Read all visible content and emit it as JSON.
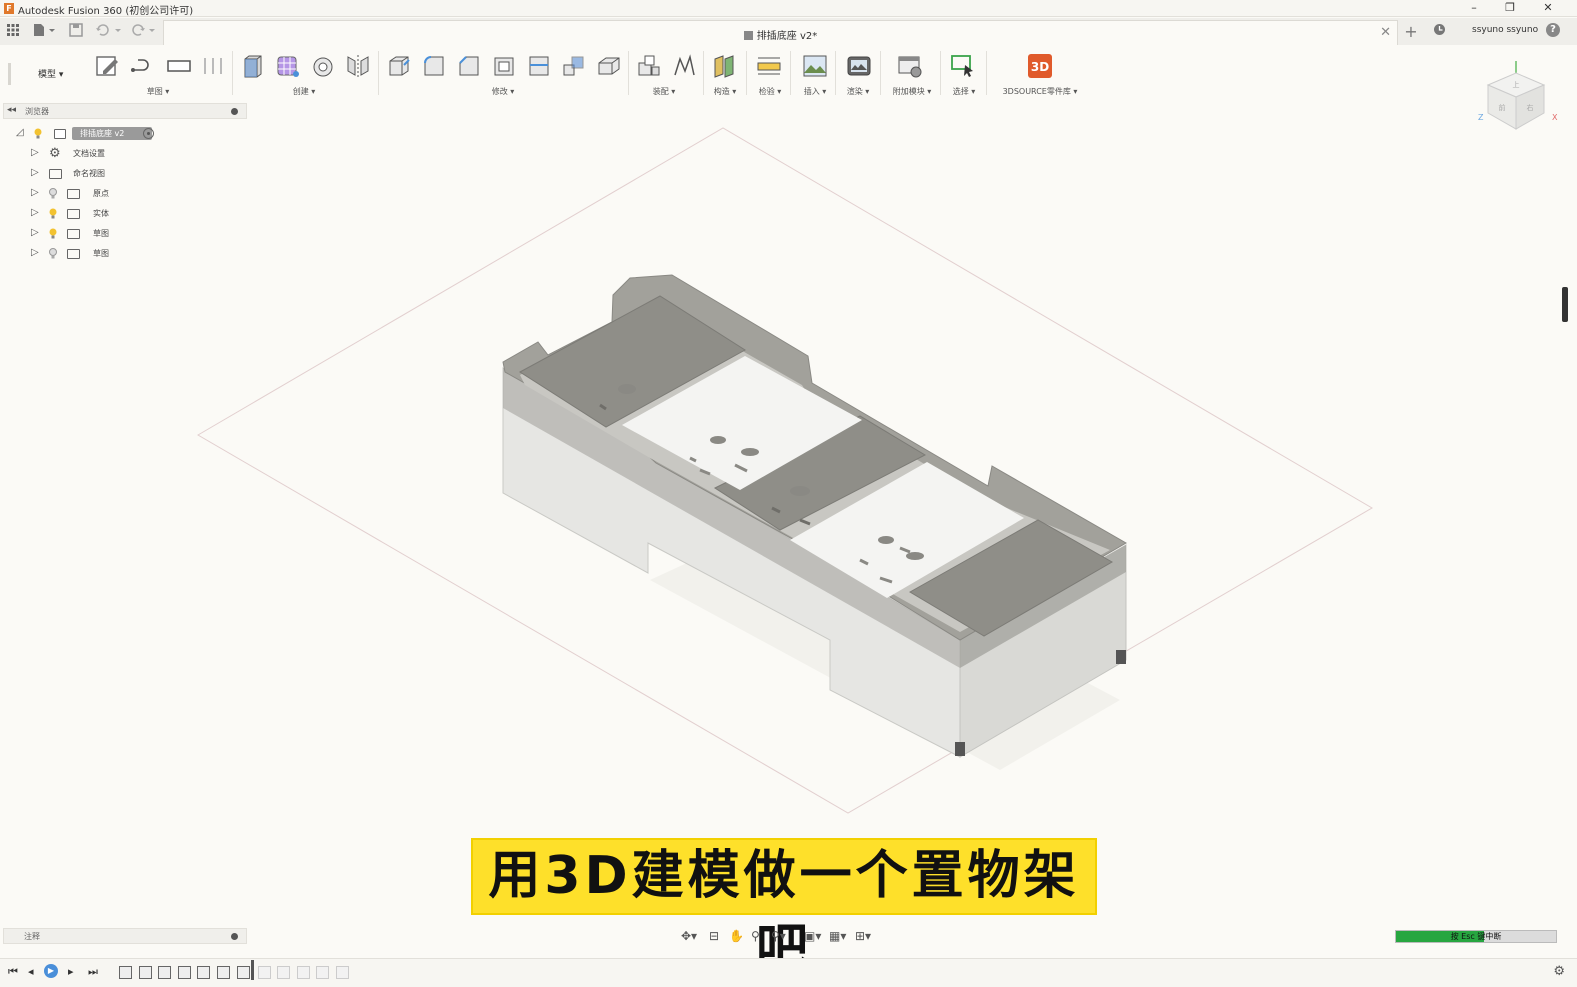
{
  "window": {
    "title": "Autodesk Fusion 360 (初创公司许可)",
    "minimize": "–",
    "restore": "❐",
    "close": "✕"
  },
  "tabs": {
    "document_name": "排插底座 v2*",
    "close": "✕",
    "new_tab": "+",
    "user": "ssyuno ssyuno",
    "help": "?"
  },
  "ribbon": {
    "workspace": "模型 ▾",
    "groups": [
      {
        "label": "草图 ▾"
      },
      {
        "label": "创建 ▾"
      },
      {
        "label": "修改 ▾"
      },
      {
        "label": "装配 ▾"
      },
      {
        "label": "构造 ▾"
      },
      {
        "label": "检验 ▾"
      },
      {
        "label": "插入 ▾"
      },
      {
        "label": "渲染 ▾"
      },
      {
        "label": "附加模块 ▾"
      },
      {
        "label": "选择 ▾"
      },
      {
        "label": "3DSOURCE零件库 ▾"
      }
    ]
  },
  "viewcube": {
    "top": "上",
    "front": "前",
    "right": "右",
    "axis_z": "Z",
    "axis_x": "X"
  },
  "browser": {
    "header": "浏览器",
    "root": "排插底座 v2",
    "items": [
      {
        "label": "文档设置"
      },
      {
        "label": "命名视图"
      },
      {
        "label": "原点"
      },
      {
        "label": "实体"
      },
      {
        "label": "草图"
      },
      {
        "label": "草图"
      }
    ]
  },
  "comments": {
    "label": "注释"
  },
  "caption": "用3D建模做一个置物架吧",
  "status": {
    "text": "按 Esc 键中断",
    "progress": 0.55,
    "color": "#27a640"
  },
  "colors": {
    "caption_bg": "#fee02a",
    "accent": "#e0782b",
    "model_dark": "#9d9c97",
    "model_light": "#e2e2df"
  }
}
